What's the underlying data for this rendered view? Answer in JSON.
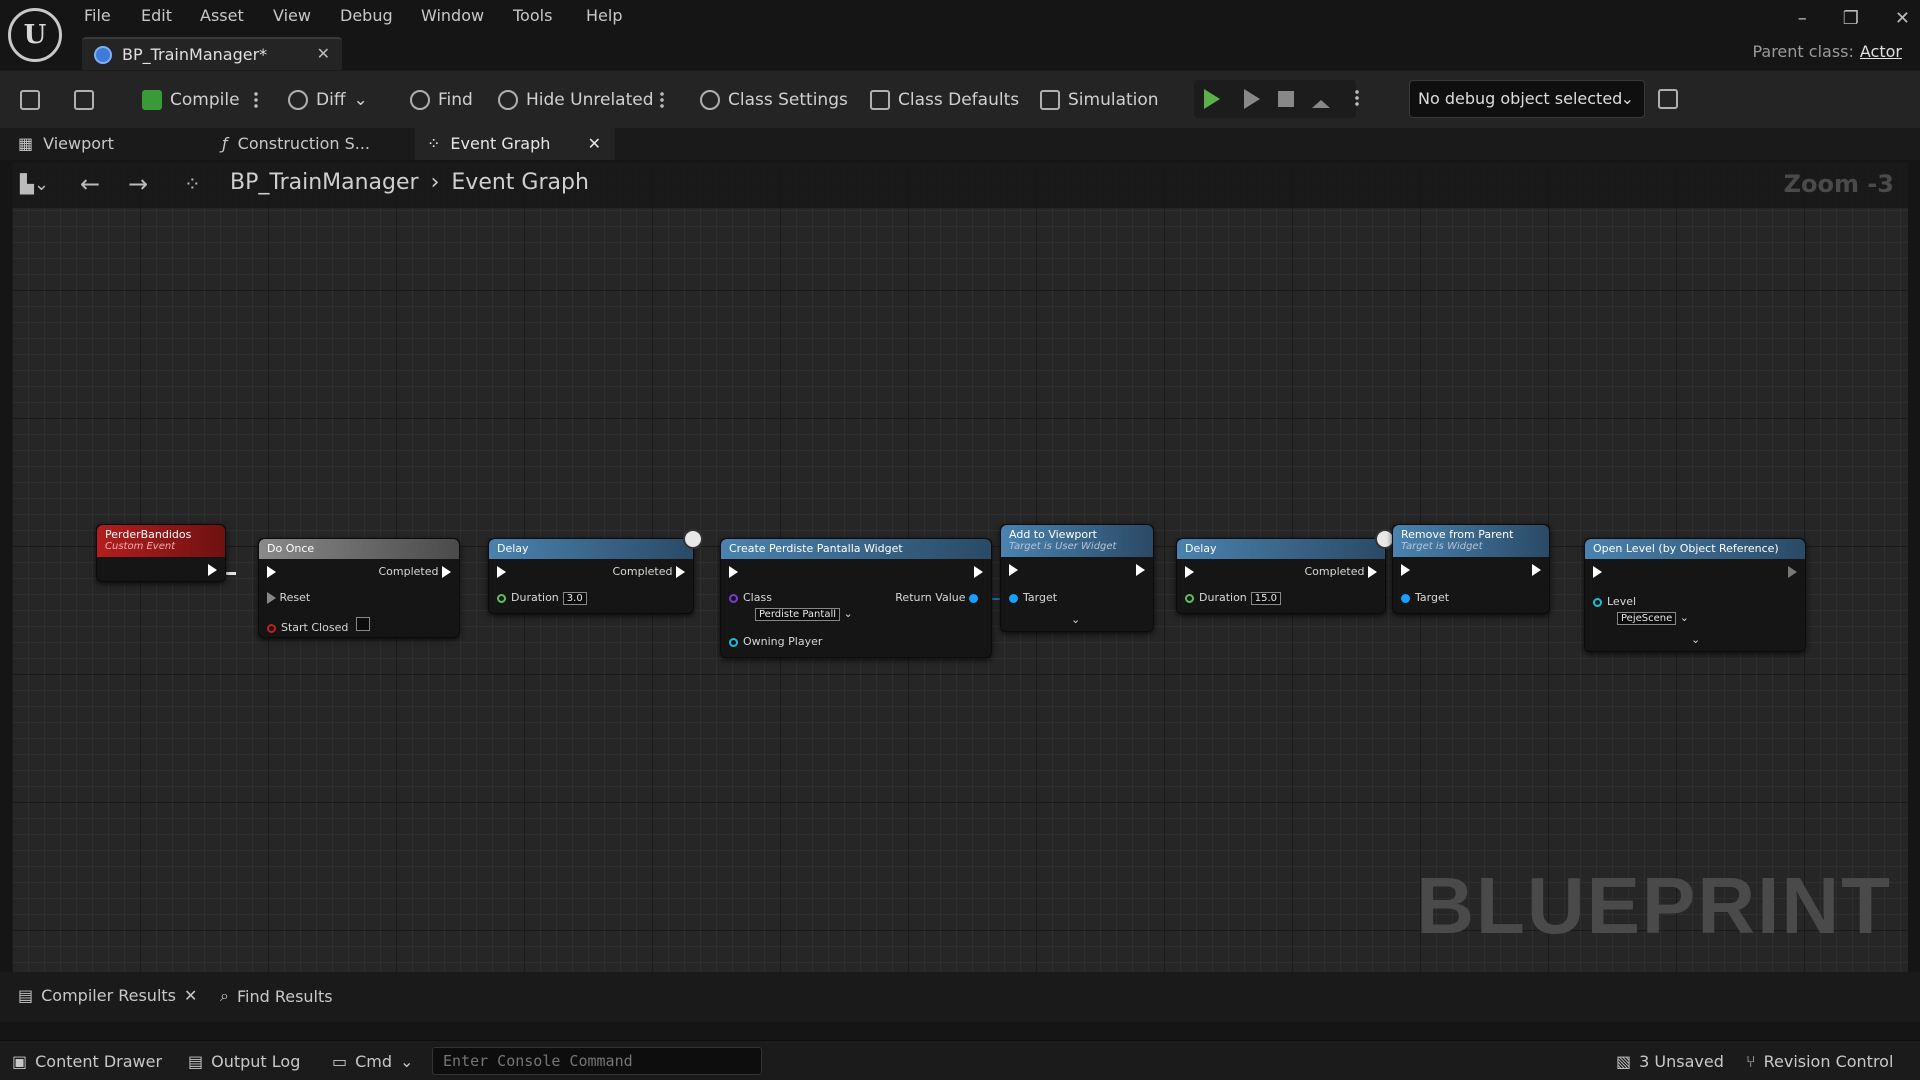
{
  "menu": [
    "File",
    "Edit",
    "Asset",
    "View",
    "Debug",
    "Window",
    "Tools",
    "Help"
  ],
  "doc_tab": {
    "label": "BP_TrainManager*"
  },
  "parent_class": {
    "label": "Parent class:",
    "value": "Actor"
  },
  "toolbar": {
    "compile": "Compile",
    "diff": "Diff",
    "find": "Find",
    "hide_unrelated": "Hide Unrelated",
    "class_settings": "Class Settings",
    "class_defaults": "Class Defaults",
    "simulation": "Simulation",
    "debug_object": "No debug object selected"
  },
  "graph_tabs": {
    "viewport": "Viewport",
    "construction": "Construction S...",
    "event_graph": "Event Graph"
  },
  "breadcrumb": {
    "blueprint": "BP_TrainManager",
    "graph": "Event Graph"
  },
  "zoom": "Zoom -3",
  "watermark": "BLUEPRINT",
  "nodes": {
    "perder": {
      "title": "PerderBandidos",
      "subtitle": "Custom Event"
    },
    "do_once": {
      "title": "Do Once",
      "completed": "Completed",
      "reset": "Reset",
      "start_closed": "Start Closed"
    },
    "delay1": {
      "title": "Delay",
      "completed": "Completed",
      "duration_label": "Duration",
      "duration": "3.0"
    },
    "create_widget": {
      "title": "Create Perdiste Pantalla Widget",
      "class_label": "Class",
      "class_value": "Perdiste Pantall",
      "return_value": "Return Value",
      "owning_player": "Owning Player"
    },
    "add_viewport": {
      "title": "Add to Viewport",
      "subtitle": "Target is User Widget",
      "target": "Target"
    },
    "delay2": {
      "title": "Delay",
      "completed": "Completed",
      "duration_label": "Duration",
      "duration": "15.0"
    },
    "remove_parent": {
      "title": "Remove from Parent",
      "subtitle": "Target is Widget",
      "target": "Target"
    },
    "open_level": {
      "title": "Open Level (by Object Reference)",
      "level_label": "Level",
      "level_value": "PejeScene"
    }
  },
  "bottom_tabs": {
    "compiler_results": "Compiler Results",
    "find_results": "Find Results"
  },
  "statusbar": {
    "content_drawer": "Content Drawer",
    "output_log": "Output Log",
    "cmd": "Cmd",
    "console_placeholder": "Enter Console Command",
    "unsaved": "3 Unsaved",
    "revision_control": "Revision Control"
  }
}
